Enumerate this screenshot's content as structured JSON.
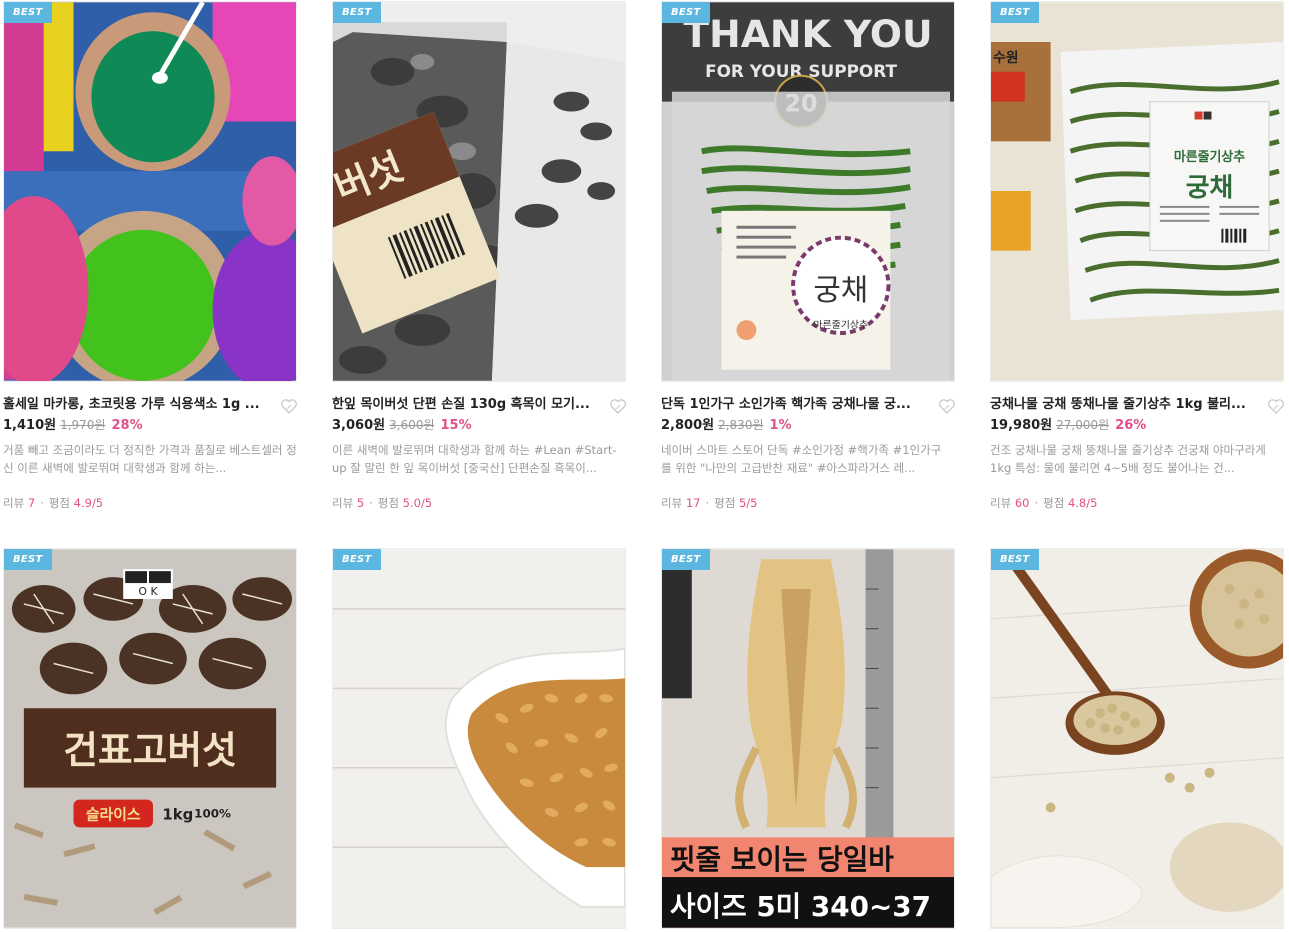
{
  "products": [
    {
      "badge": "BEST",
      "title": "홀세일 마카롱, 초코릿용 가루 식용색소 1g ...",
      "price": "1,410원",
      "orig": "1,970원",
      "discount": "28%",
      "desc": "거품 빼고 조금이라도 더 정직한 가격과 품질로 베스트셀러 정신  이른 새벽에 발로뛰며 대학생과 함께 하는...",
      "review_label": "리뷰",
      "review_count": "7",
      "rating_label": "평점",
      "rating": "4.9",
      "rating_max": "/5"
    },
    {
      "badge": "BEST",
      "title": "한잎 목이버섯 단편 손질 130g 흑목이 모기...",
      "price": "3,060원",
      "orig": "3,600원",
      "discount": "15%",
      "desc": "이른 새벽에 발로뛰며 대학생과 함께 하는 #Lean #Start-up 잘 말린 한 잎 목이버섯 [중국산] 단편손질 흑목이...",
      "review_label": "리뷰",
      "review_count": "5",
      "rating_label": "평점",
      "rating": "5.0",
      "rating_max": "/5"
    },
    {
      "badge": "BEST",
      "title": "단독 1인가구 소인가족 핵가족 궁채나물 궁...",
      "price": "2,800원",
      "orig": "2,830원",
      "discount": "1%",
      "desc": "네이버 스마트 스토어 단독 #소인가정 #핵가족 #1인가구 를 위한 \"나만의 고급반찬 재료\" #아스파라거스 레...",
      "review_label": "리뷰",
      "review_count": "17",
      "rating_label": "평점",
      "rating": "5",
      "rating_max": "/5"
    },
    {
      "badge": "BEST",
      "title": "궁채나물 궁채 뚱채나물 줄기상추 1kg 불리...",
      "price": "19,980원",
      "orig": "27,000원",
      "discount": "26%",
      "desc": "건조 궁채나물 궁채 뚱채나물 줄기상추 건궁채 야마구라게 1kg 특성: 물에 불리면 4~5배 정도 불어나는 건...",
      "review_label": "리뷰",
      "review_count": "60",
      "rating_label": "평점",
      "rating": "4.8",
      "rating_max": "/5"
    },
    {
      "badge": "BEST",
      "label_text": "건표고버섯",
      "label_sub": "슬라이스",
      "label_weight": "1kg",
      "label_pct": "100%",
      "brand": "O K"
    },
    {
      "badge": "BEST"
    },
    {
      "badge": "BEST",
      "overlay_line1": "핏줄 보이는 당일바",
      "overlay_line2": "사이즈 5미 340~37"
    },
    {
      "badge": "BEST"
    }
  ],
  "image_texts": {
    "p2_label": "버섯",
    "p3_banner1": "THANK YOU",
    "p3_banner2": "FOR YOUR SUPPORT",
    "p3_years": "20",
    "p3_label": "궁채",
    "p3_label_sub": "마른줄기상추",
    "p4_price_tag": "수원",
    "p4_label_top": "마른줄기상추",
    "p4_label": "궁채"
  },
  "colors": {
    "badge": "#5bb6e0",
    "discount": "#e0508a",
    "muted": "#9a9a9a"
  }
}
